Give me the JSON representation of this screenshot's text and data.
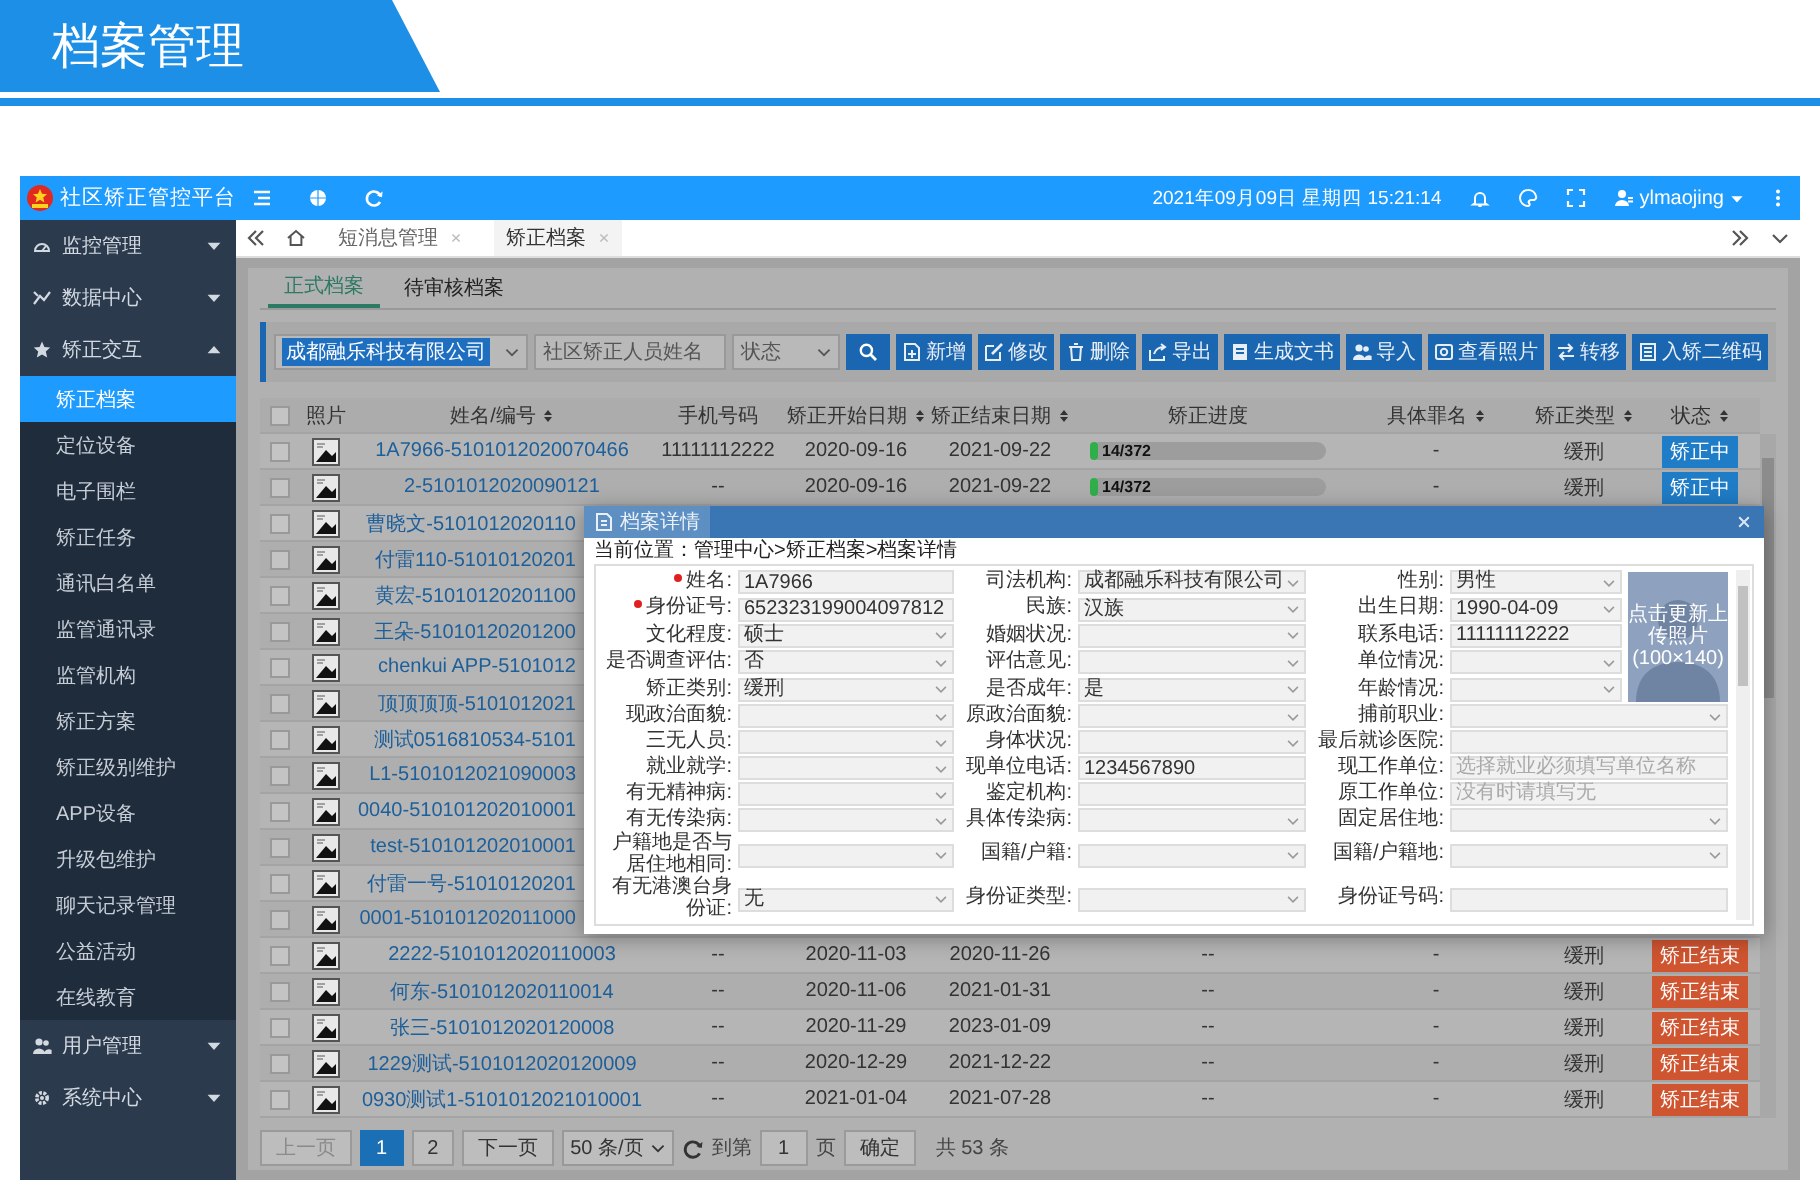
{
  "page_title": "档案管理",
  "sidebar": {
    "app_name": "社区矫正管控平台",
    "groups": [
      {
        "label": "监控管理",
        "expanded": false
      },
      {
        "label": "数据中心",
        "expanded": false
      },
      {
        "label": "矫正交互",
        "expanded": true,
        "children": [
          {
            "label": "矫正档案",
            "selected": true
          },
          {
            "label": "定位设备",
            "selected": false
          },
          {
            "label": "电子围栏",
            "selected": false
          },
          {
            "label": "矫正任务",
            "selected": false
          },
          {
            "label": "通讯白名单",
            "selected": false
          },
          {
            "label": "监管通讯录",
            "selected": false
          },
          {
            "label": "监管机构",
            "selected": false
          },
          {
            "label": "矫正方案",
            "selected": false
          },
          {
            "label": "矫正级别维护",
            "selected": false
          },
          {
            "label": "APP设备",
            "selected": false
          },
          {
            "label": "升级包维护",
            "selected": false
          },
          {
            "label": "聊天记录管理",
            "selected": false
          },
          {
            "label": "公益活动",
            "selected": false
          },
          {
            "label": "在线教育",
            "selected": false
          }
        ]
      },
      {
        "label": "用户管理",
        "expanded": false
      },
      {
        "label": "系统中心",
        "expanded": false
      }
    ]
  },
  "topbar": {
    "datetime": "2021年09月09日 星期四 15:21:14",
    "user": "ylmaojing"
  },
  "tabs": [
    {
      "label": "短消息管理",
      "selected": false
    },
    {
      "label": "矫正档案",
      "selected": true
    }
  ],
  "subtabs": [
    {
      "label": "正式档案",
      "selected": true
    },
    {
      "label": "待审核档案",
      "selected": false
    }
  ],
  "filters": {
    "org": {
      "value": "成都融乐科技有限公司"
    },
    "name": {
      "placeholder": "社区矫正人员姓名"
    },
    "status": {
      "placeholder": "状态"
    }
  },
  "toolbar": [
    "新增",
    "修改",
    "删除",
    "导出",
    "生成文书",
    "导入",
    "查看照片",
    "转移",
    "入矫二维码"
  ],
  "table": {
    "select_all_checked": false,
    "columns": [
      {
        "label": "照片",
        "sortable": false
      },
      {
        "label": "姓名/编号",
        "sortable": true
      },
      {
        "label": "手机号码",
        "sortable": false
      },
      {
        "label": "矫正开始日期",
        "sortable": true
      },
      {
        "label": "矫正结束日期",
        "sortable": true
      },
      {
        "label": "矫正进度",
        "sortable": false
      },
      {
        "label": "具体罪名",
        "sortable": true
      },
      {
        "label": "矫正类型",
        "sortable": true
      },
      {
        "label": "状态",
        "sortable": true
      }
    ],
    "rows": [
      {
        "checked": false,
        "name": "1A7966-5101012020070466",
        "phone": "11111112222",
        "start": "2020-09-16",
        "end": "2021-09-22",
        "progress": {
          "text": "14/372",
          "level": 0.038
        },
        "crime": "-",
        "type": "缓刑",
        "status": {
          "text": "矫正中",
          "color": "#1f7cc6"
        }
      },
      {
        "checked": false,
        "name": "2-5101012020090121",
        "phone": "--",
        "start": "2020-09-16",
        "end": "2021-09-22",
        "progress": {
          "text": "14/372",
          "level": 0.038
        },
        "crime": "-",
        "type": "缓刑",
        "status": {
          "text": "矫正中",
          "color": "#1f7cc6"
        }
      },
      {
        "checked": false,
        "name": "曹晓文-5101012020110"
      },
      {
        "checked": false,
        "name": "付雷110-51010120201"
      },
      {
        "checked": false,
        "name": "黄宏-51010120201100"
      },
      {
        "checked": false,
        "name": "王朵-51010120201200"
      },
      {
        "checked": false,
        "name": "chenkui APP-5101012"
      },
      {
        "checked": false,
        "name": "顶顶顶顶-5101012021"
      },
      {
        "checked": false,
        "name": "测试0516810534-5101"
      },
      {
        "checked": false,
        "name": "L1-5101012021090003"
      },
      {
        "checked": false,
        "name": "0040-510101202010001"
      },
      {
        "checked": false,
        "name": "test-510101202010001"
      },
      {
        "checked": false,
        "name": "付雷一号-51010120201"
      },
      {
        "checked": false,
        "name": "0001-510101202011000"
      },
      {
        "checked": false,
        "name": "2222-5101012020110003",
        "phone": "--",
        "start": "2020-11-03",
        "end": "2020-11-26",
        "progress": {
          "text": "--"
        },
        "crime": "-",
        "type": "缓刑",
        "status": {
          "text": "矫正结束",
          "color": "#cf5430"
        }
      },
      {
        "checked": false,
        "name": "何东-5101012020110014",
        "phone": "--",
        "start": "2020-11-06",
        "end": "2021-01-31",
        "progress": {
          "text": "--"
        },
        "crime": "-",
        "type": "缓刑",
        "status": {
          "text": "矫正结束",
          "color": "#cf5430"
        }
      },
      {
        "checked": false,
        "name": "张三-5101012020120008",
        "phone": "--",
        "start": "2020-11-29",
        "end": "2023-01-09",
        "progress": {
          "text": "--"
        },
        "crime": "-",
        "type": "缓刑",
        "status": {
          "text": "矫正结束",
          "color": "#cf5430"
        }
      },
      {
        "checked": false,
        "name": "1229测试-5101012020120009",
        "phone": "--",
        "start": "2020-12-29",
        "end": "2021-12-22",
        "progress": {
          "text": "--"
        },
        "crime": "-",
        "type": "缓刑",
        "status": {
          "text": "矫正结束",
          "color": "#cf5430"
        }
      },
      {
        "checked": false,
        "name": "0930测试1-5101012021010001",
        "phone": "--",
        "start": "2021-01-04",
        "end": "2021-07-28",
        "progress": {
          "text": "--"
        },
        "crime": "-",
        "type": "缓刑",
        "status": {
          "text": "矫正结束",
          "color": "#cf5430"
        }
      }
    ]
  },
  "pagination": {
    "prev": {
      "label": "上一页",
      "disabled": true
    },
    "pages": [
      {
        "label": "1",
        "selected": true
      },
      {
        "label": "2",
        "selected": false
      }
    ],
    "next": "下一页",
    "page_size": "50 条/页",
    "goto_label": "到第",
    "goto_value": "1",
    "page_unit": "页",
    "confirm": "确定",
    "total": "共 53 条"
  },
  "modal": {
    "title": "档案详情",
    "breadcrumb": "当前位置：管理中心>矫正档案>档案详情",
    "photo": {
      "caption": "点击更新上传照片",
      "size": "(100×140)"
    },
    "fields": [
      {
        "label": "姓名:",
        "required": true,
        "kind": "input",
        "value": "1A7966"
      },
      {
        "label": "司法机构:",
        "required": false,
        "kind": "select",
        "value": "成都融乐科技有限公司"
      },
      {
        "label": "性别:",
        "required": false,
        "kind": "select",
        "value": "男性"
      },
      {
        "label": "身份证号:",
        "required": true,
        "kind": "input",
        "value": "652323199004097812"
      },
      {
        "label": "民族:",
        "required": false,
        "kind": "select",
        "value": "汉族"
      },
      {
        "label": "出生日期:",
        "required": false,
        "kind": "select",
        "value": "1990-04-09"
      },
      {
        "label": "文化程度:",
        "required": false,
        "kind": "select",
        "value": "硕士"
      },
      {
        "label": "婚姻状况:",
        "required": false,
        "kind": "select"
      },
      {
        "label": "联系电话:",
        "required": false,
        "kind": "input",
        "value": "11111112222"
      },
      {
        "label": "是否调查评估:",
        "required": false,
        "kind": "select",
        "value": "否"
      },
      {
        "label": "评估意见:",
        "required": false,
        "kind": "select"
      },
      {
        "label": "单位情况:",
        "required": false,
        "kind": "select"
      },
      {
        "label": "矫正类别:",
        "required": false,
        "kind": "select",
        "value": "缓刑"
      },
      {
        "label": "是否成年:",
        "required": false,
        "kind": "select",
        "value": "是"
      },
      {
        "label": "年龄情况:",
        "required": false,
        "kind": "select"
      },
      {
        "label": "现政治面貌:",
        "required": false,
        "kind": "select"
      },
      {
        "label": "原政治面貌:",
        "required": false,
        "kind": "select"
      },
      {
        "label": "捕前职业:",
        "required": false,
        "kind": "select"
      },
      {
        "label": "三无人员:",
        "required": false,
        "kind": "select"
      },
      {
        "label": "身体状况:",
        "required": false,
        "kind": "select"
      },
      {
        "label": "最后就诊医院:",
        "required": false,
        "kind": "input"
      },
      {
        "label": "就业就学:",
        "required": false,
        "kind": "select"
      },
      {
        "label": "现单位电话:",
        "required": false,
        "kind": "input",
        "value": "1234567890"
      },
      {
        "label": "现工作单位:",
        "required": false,
        "kind": "input",
        "placeholder": "选择就业必须填写单位名称"
      },
      {
        "label": "有无精神病:",
        "required": false,
        "kind": "select"
      },
      {
        "label": "鉴定机构:",
        "required": false,
        "kind": "input"
      },
      {
        "label": "原工作单位:",
        "required": false,
        "kind": "input",
        "placeholder": "没有时请填写无"
      },
      {
        "label": "有无传染病:",
        "required": false,
        "kind": "select"
      },
      {
        "label": "具体传染病:",
        "required": false,
        "kind": "select"
      },
      {
        "label": "固定居住地:",
        "required": false,
        "kind": "select"
      },
      {
        "label": "户籍地是否与居住地相同:",
        "required": false,
        "kind": "select"
      },
      {
        "label": "国籍/户籍:",
        "required": false,
        "kind": "select"
      },
      {
        "label": "国籍/户籍地:",
        "required": false,
        "kind": "select"
      },
      {
        "label": "有无港澳台身份证:",
        "required": false,
        "kind": "select",
        "value": "无"
      },
      {
        "label": "身份证类型:",
        "required": false,
        "kind": "select"
      },
      {
        "label": "身份证号码:",
        "required": false,
        "kind": "input"
      }
    ]
  }
}
